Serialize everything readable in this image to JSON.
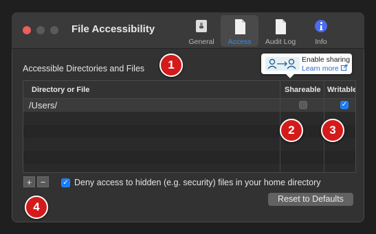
{
  "window": {
    "title": "File Accessibility"
  },
  "toolbar": {
    "tabs": [
      {
        "label": "General",
        "icon": "switch-icon"
      },
      {
        "label": "Access",
        "icon": "document-icon",
        "active": true
      },
      {
        "label": "Audit Log",
        "icon": "document-icon"
      },
      {
        "label": "Info",
        "icon": "info-icon"
      }
    ]
  },
  "section": {
    "title": "Accessible Directories and Files"
  },
  "tooltip": {
    "line1": "Enable sharing",
    "line2": "Learn more"
  },
  "table": {
    "headers": [
      "Directory or File",
      "Shareable",
      "Writable"
    ],
    "rows": [
      {
        "path": "/Users/",
        "shareable": false,
        "writable": true
      }
    ]
  },
  "controls": {
    "add_label": "+",
    "remove_label": "−",
    "deny_checked": true,
    "deny_label": "Deny access to hidden (e.g. security) files in your home directory",
    "reset_label": "Reset to Defaults"
  },
  "annotations": [
    "1",
    "2",
    "3",
    "4"
  ],
  "colors": {
    "accent": "#1a7cf5",
    "badge": "#d41a1a",
    "close": "#ec5f5b"
  }
}
